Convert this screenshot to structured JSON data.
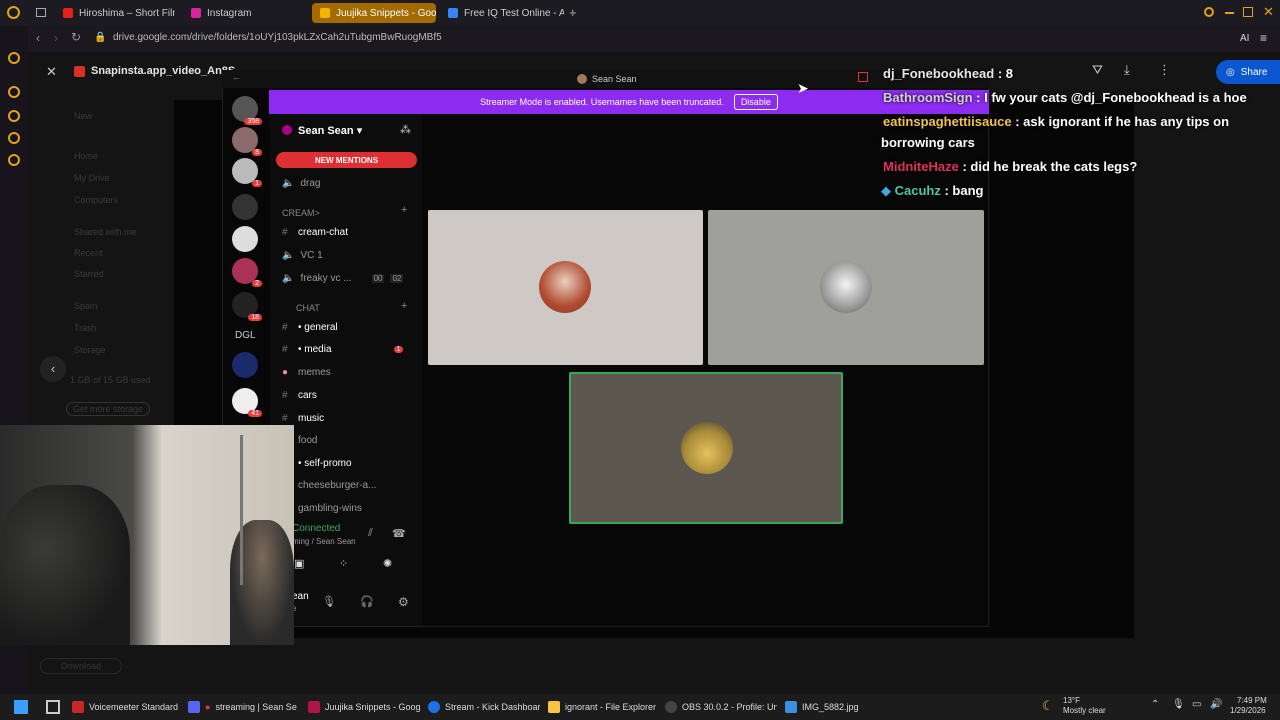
{
  "browser": {
    "tabs": [
      {
        "label": "Hiroshima – Short Film - Y",
        "color": "#e62117"
      },
      {
        "label": "Instagram",
        "color": "#d6249f"
      },
      {
        "label": "Juujika Snippets - Google",
        "color": "#f4b400"
      },
      {
        "label": "Free IQ Test Online - Accu",
        "color": "#3b82f6"
      }
    ],
    "new_tab": "+",
    "url": "drive.google.com/drive/folders/1oUYj103pkLZxCah2uTubgmBwRuogMBf5",
    "ai_label": "AI"
  },
  "drive": {
    "file_title": "Snapinsta.app_video_An8S",
    "share_label": "Share",
    "sidebar": [
      "New",
      "Home",
      "My Drive",
      "Computers",
      "Shared with me",
      "Recent",
      "Starred",
      "Spam",
      "Trash",
      "Storage"
    ],
    "storage_text": "1 GB of 15 GB used",
    "get_storage": "Get more storage",
    "download": "Download"
  },
  "discord": {
    "window_title": "Sean Sean",
    "streamer_text": "Streamer Mode is enabled. Usernames have been truncated.",
    "disable_label": "Disable",
    "server_name": "Sean Sean",
    "new_mentions": "NEW MENTIONS",
    "servers": [
      {
        "badge": "358"
      },
      {
        "badge": "8"
      },
      {
        "badge": "1"
      },
      {
        "badge": ""
      },
      {
        "badge": ""
      },
      {
        "badge": "2"
      },
      {
        "badge": "18"
      },
      {
        "label": "DGL",
        "badge": ""
      },
      {
        "badge": ""
      },
      {
        "badge": "41"
      }
    ],
    "channels": {
      "drag": "drag",
      "cat_cream": "CREAM>",
      "cream_chat": "cream-chat",
      "vc1": "VC 1",
      "freaky": "freaky vc ...",
      "freaky_count_a": "00",
      "freaky_count_b": "02",
      "cat_chat": "CHAT",
      "general": "• general",
      "media": "• media",
      "media_badge": "1",
      "memes": "memes",
      "cars": "cars",
      "music": "music",
      "food": "food",
      "self_promo": "• self-promo",
      "cheeseburger": "cheeseburger-a...",
      "gambling": "gambling-wins"
    },
    "voice": {
      "status": "Connected",
      "sub": "ming / Sean Sean",
      "user": "ean",
      "user_sub": "e"
    },
    "tiles_colors": [
      "#cfc9c5",
      "#9f9f9c",
      "#5c574f"
    ]
  },
  "chat_overlay": [
    {
      "user": "dj_Fonebookhead",
      "msg": " : 8",
      "color": "#e6e6e6"
    },
    {
      "user": "BathroomSign",
      "msg": " : I fw your cats @dj_Fonebookhead is a hoe",
      "color": "#cfcfcf"
    },
    {
      "user": "eatinspaghettiisauce",
      "msg": " : ask ignorant if he has any tips on",
      "color": "#f2c14e"
    },
    {
      "user": "",
      "msg": "borrowing cars",
      "color": "#ffffff"
    },
    {
      "user": "MidniteHaze",
      "msg": " : did he break the cats legs?",
      "color": "#e0315b"
    },
    {
      "user": "Cacuhz",
      "msg": " : bang",
      "color": "#4cc9a4"
    }
  ],
  "taskbar": {
    "items": [
      {
        "label": "Voicemeeter Standard",
        "color": "#c62828"
      },
      {
        "label": "streaming | Sean Se",
        "color": "#5865f2"
      },
      {
        "label": "Juujika Snippets - Goog",
        "color": "#b0154a"
      },
      {
        "label": "Stream - Kick Dashboar",
        "color": "#1a73e8"
      },
      {
        "label": "ignorant - File Explorer",
        "color": "#f6c343"
      },
      {
        "label": "OBS 30.0.2 - Profile: Unt",
        "color": "#444444"
      },
      {
        "label": "IMG_5882.jpg",
        "color": "#3d8fe0"
      }
    ],
    "weather_temp": "13°F",
    "weather_desc": "Mostly clear",
    "time": "7:49 PM",
    "date": "1/29/2026"
  }
}
